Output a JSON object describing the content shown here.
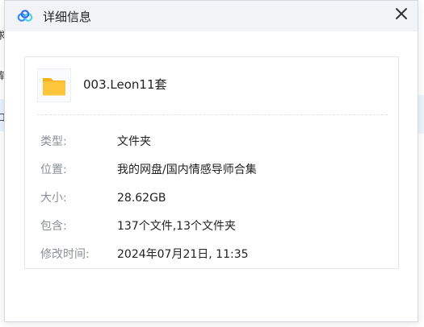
{
  "background": {
    "left_fragments": [
      "求",
      "库",
      "口"
    ]
  },
  "dialog": {
    "title": "详细信息",
    "app_icon": "baidu-netdisk-logo-icon",
    "close_icon": "close-icon"
  },
  "file": {
    "name": "003.Leon11套",
    "icon": "folder-icon"
  },
  "details": [
    {
      "label": "类型:",
      "value": "文件夹"
    },
    {
      "label": "位置:",
      "value": "我的网盘/国内情感导师合集"
    },
    {
      "label": "大小:",
      "value": "28.62GB"
    },
    {
      "label": "包含:",
      "value": "137个文件,13个文件夹"
    },
    {
      "label": "修改时间:",
      "value": "2024年07月21日, 11:35"
    }
  ],
  "colors": {
    "titlebar_bg": "#f2f3f7",
    "label_text": "#8a8e95",
    "value_text": "#222222",
    "folder_yellow": "#fcc53c",
    "logo_blue": "#3a8ff5",
    "logo_cyan": "#4fd0e8"
  }
}
